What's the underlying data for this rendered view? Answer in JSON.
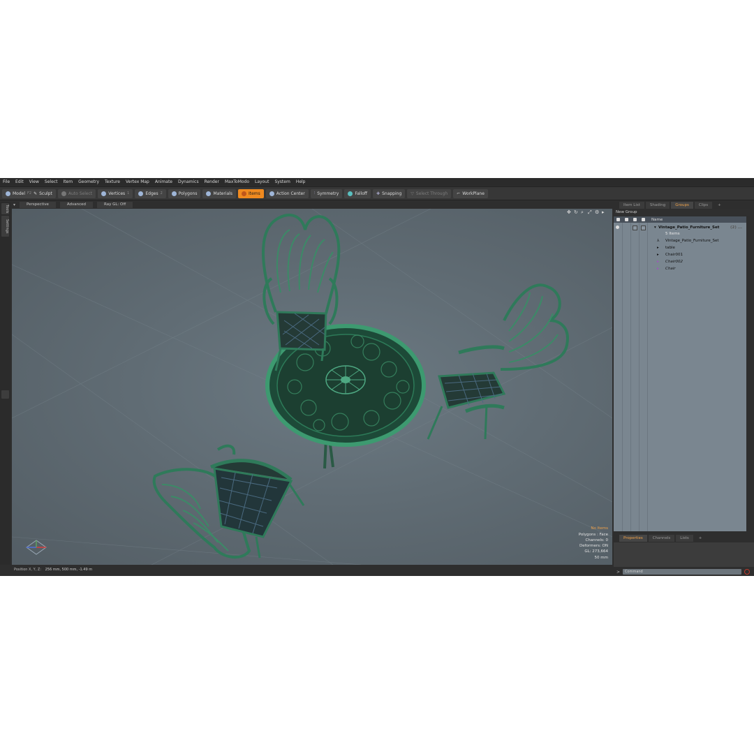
{
  "menu": [
    "File",
    "Edit",
    "View",
    "Select",
    "Item",
    "Geometry",
    "Texture",
    "Vertex Map",
    "Animate",
    "Dynamics",
    "Render",
    "MaxToModo",
    "Layout",
    "System",
    "Help"
  ],
  "toolbar": {
    "model": "Model",
    "model_key": "F2",
    "sculpt": "Sculpt",
    "auto_select": "Auto Select",
    "vertices": "Vertices",
    "vertices_key": "1",
    "edges": "Edges",
    "edges_key": "2",
    "polygons": "Polygons",
    "materials": "Materials",
    "items": "Items",
    "action_center": "Action Center",
    "symmetry": "Symmetry",
    "falloff": "Falloff",
    "snapping": "Snapping",
    "select_through": "Select Through",
    "workplane": "WorkPlane"
  },
  "left_tabs": [
    "Tools",
    "Settings"
  ],
  "viewport": {
    "tabs": [
      "Perspective",
      "Advanced",
      "Ray GL: Off"
    ],
    "info": {
      "selection": "No Items",
      "polygons": "Polygons : Face",
      "channels": "Channels: 0",
      "deformers": "Deformers: ON",
      "gl": "GL: 273,664",
      "scale": "50 mm"
    }
  },
  "status": {
    "label": "Position X, Y, Z:",
    "value": "256 mm, 500 mm, -1.49 m"
  },
  "right_panel": {
    "tabs": [
      "Item List",
      "Shading",
      "Groups",
      "Clips",
      "+"
    ],
    "active_tab": "Groups",
    "new_group": "New Group",
    "column_name": "Name",
    "groups": {
      "root_name": "Vintage_Patio_Furniture_Set",
      "root_count": "(2) ...",
      "items_count": "5 Items",
      "children": [
        "Vintage_Patio_Furniture_Set",
        "table",
        "Chair001",
        "Chair002",
        "Chair"
      ]
    },
    "bottom_tabs": [
      "Properties",
      "Channels",
      "Lists",
      "+"
    ],
    "command_placeholder": "Command"
  },
  "colors": {
    "accent": "#f08a1f",
    "viewport_bg": "#606c74",
    "furniture_green": "#2f7a5a"
  }
}
